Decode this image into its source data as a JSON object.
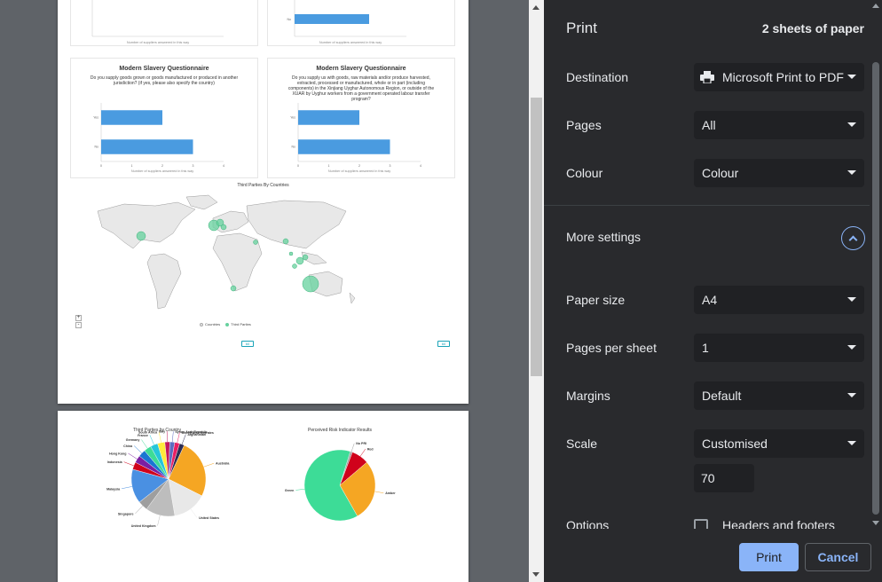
{
  "preview": {
    "card_title_1": "Modern Slavery Questionnaire",
    "card_q_1": "Do you supply goods grown or goods manufactured or produced in another jurisdiction? (if yes, please also specify the country)",
    "card_title_2": "Modern Slavery Questionnaire",
    "card_q_2": "Do you supply us with goods, raw materials and/or produce harvested, extracted, processed or manufactured, whole or in part (including components) in the Xinjiang Uyghur Autonomous Region, or outside of the XUAR by Uyghur workers from a government operated labour transfer program?",
    "axis_caption": "Number of suppliers answered in this way",
    "bar_labels": [
      "Yes",
      "No"
    ],
    "map_title": "Third Parties By Countries",
    "legend_countries": "Countries",
    "legend_third_parties": "Third Parties",
    "zoom_in": "+",
    "zoom_out": "-",
    "chip_label": "60",
    "pie1_title": "Third Parties by Country",
    "pie2_title": "Perceived Risk Indicator Results",
    "colors": {
      "bar": "#4a9be0",
      "bubble": "#66d19e",
      "amber": "#f5a623",
      "green": "#3ddc97",
      "red": "#d0021b"
    }
  },
  "chart_data": [
    {
      "type": "bar",
      "title": "Modern Slavery Questionnaire",
      "xlabel": "Number of suppliers answered in this way",
      "categories": [
        "Yes",
        "No"
      ],
      "values": [
        2,
        3
      ],
      "xlim": [
        0,
        4
      ]
    },
    {
      "type": "bar",
      "title": "Modern Slavery Questionnaire",
      "xlabel": "Number of suppliers answered in this way",
      "categories": [
        "Yes",
        "No"
      ],
      "values": [
        2,
        3
      ],
      "xlim": [
        0,
        4
      ]
    },
    {
      "type": "pie",
      "title": "Third Parties by Country",
      "labels": [
        "Afghanistan",
        "Australia",
        "United States",
        "United Kingdom",
        "Singapore",
        "Malaysia",
        "Indonesia",
        "Hong Kong",
        "China",
        "Germany",
        "France",
        "South Africa",
        "Italy",
        "Syrian Arab Republic",
        "United Arab Emirates"
      ],
      "values": [
        2,
        24,
        14,
        12,
        4,
        14,
        3,
        3,
        3,
        3,
        3,
        3,
        2,
        2,
        2
      ]
    },
    {
      "type": "pie",
      "title": "Perceived Risk Indicator Results",
      "labels": [
        "No PRI",
        "Red",
        "Amber",
        "Green"
      ],
      "values": [
        1,
        8,
        28,
        63
      ]
    }
  ],
  "panel": {
    "title": "Print",
    "sheets": "2 sheets of paper",
    "destination_label": "Destination",
    "destination_value": "Microsoft Print to PDF",
    "pages_label": "Pages",
    "pages_value": "All",
    "colour_label": "Colour",
    "colour_value": "Colour",
    "more_settings": "More settings",
    "paper_size_label": "Paper size",
    "paper_size_value": "A4",
    "pps_label": "Pages per sheet",
    "pps_value": "1",
    "margins_label": "Margins",
    "margins_value": "Default",
    "scale_label": "Scale",
    "scale_value": "Customised",
    "scale_input": "70",
    "options_label": "Options",
    "headers_footers": "Headers and footers",
    "print_button": "Print",
    "cancel_button": "Cancel"
  }
}
